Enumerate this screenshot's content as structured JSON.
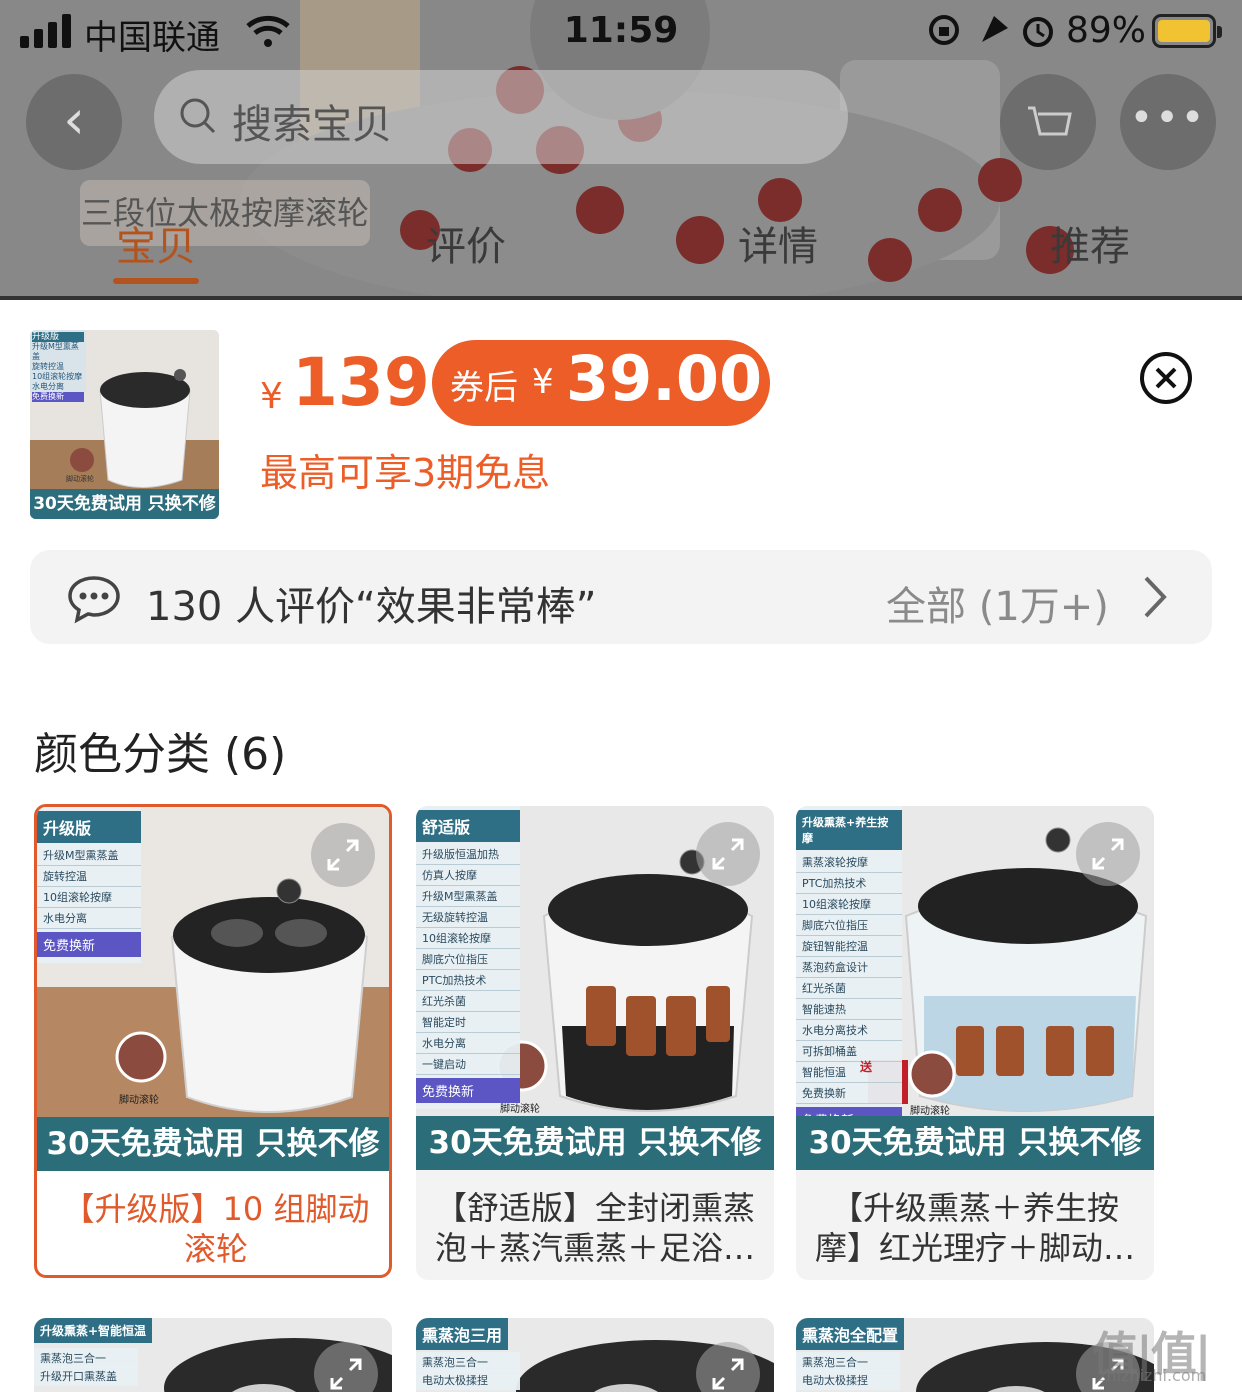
{
  "status_bar": {
    "carrier": "中国联通",
    "time": "11:59",
    "battery": "89%",
    "battery_color": "#f1c232"
  },
  "background_page": {
    "search_placeholder": "搜索宝贝",
    "promo_chip": "三段位太极按摩滚轮",
    "tabs": [
      {
        "label": "宝贝",
        "active": true
      },
      {
        "label": "评价",
        "active": false
      },
      {
        "label": "详情",
        "active": false
      },
      {
        "label": "推荐",
        "active": false
      }
    ]
  },
  "sheet": {
    "thumbnail": {
      "tag_lines": [
        "升级版",
        "升级M型熏蒸盖",
        "旋转控温",
        "10组滚轮按摩",
        "水电分离",
        "免费换新"
      ],
      "foot_label": "脚动滚轮",
      "promo": "30天免费试用 只换不修"
    },
    "price": {
      "currency": "¥",
      "amount": "139",
      "coupon_label": "券后",
      "coupon_currency": "¥",
      "coupon_amount": "39.00",
      "installment": "最高可享3期免息"
    },
    "review": {
      "text": "130 人评价“效果非常棒”",
      "all_label": "全部 (1万+)"
    },
    "section_title": "颜色分类 (6)",
    "options": [
      {
        "selected": true,
        "spec_title": "升级版",
        "spec_items": [
          "升级M型熏蒸盖",
          "旋转控温",
          "10组滚轮按摩",
          "水电分离"
        ],
        "spec_highlight": "免费换新",
        "foot_label": "脚动滚轮",
        "banner": "30天免费试用 只换不修",
        "name": "【升级版】10 组脚动滚轮"
      },
      {
        "selected": false,
        "spec_title": "舒适版",
        "spec_items": [
          "升级版恒温加热",
          "仿真人按摩",
          "升级M型熏蒸盖",
          "无级旋转控温",
          "10组滚轮按摩",
          "脚底穴位指压",
          "PTC加热技术",
          "红光杀菌",
          "智能定时",
          "水电分离",
          "一键启动"
        ],
        "spec_highlight": "免费换新",
        "foot_label": "脚动滚轮",
        "banner": "30天免费试用 只换不修",
        "name": "【舒适版】全封闭熏蒸泡＋蒸汽熏蒸＋足浴…"
      },
      {
        "selected": false,
        "spec_title": "升级熏蒸+养生按摩",
        "spec_items": [
          "熏蒸滚轮按摩",
          "PTC加热技术",
          "10组滚轮按摩",
          "脚底穴位指压",
          "旋钮智能控温",
          "蒸泡药盒设计",
          "红光杀菌",
          "智能速热",
          "水电分离技术",
          "可拆卸桶盖",
          "智能恒温",
          "免费换新"
        ],
        "spec_highlight": "免费换新",
        "foot_label": "脚动滚轮",
        "gift_label": "送",
        "banner": "30天免费试用 只换不修",
        "name": "【升级熏蒸＋养生按摩】红光理疗＋脚动…"
      }
    ],
    "options_row2": [
      {
        "spec_title": "升级熏蒸+智能恒温",
        "items": [
          "熏蒸泡三合一",
          "升级开口熏蒸盖"
        ]
      },
      {
        "spec_title": "熏蒸泡三用",
        "items": [
          "熏蒸泡三合一",
          "电动太极揉捏"
        ]
      },
      {
        "spec_title": "熏蒸泡全配置",
        "items": [
          "熏蒸泡三合一",
          "电动太极揉捏"
        ]
      }
    ],
    "watermark": "值|值|值",
    "watermark_sub": "zhizhizhi.com"
  },
  "colors": {
    "accent": "#ec5d28",
    "selected_border": "#e15a2b",
    "banner_teal": "#2b6d79"
  }
}
